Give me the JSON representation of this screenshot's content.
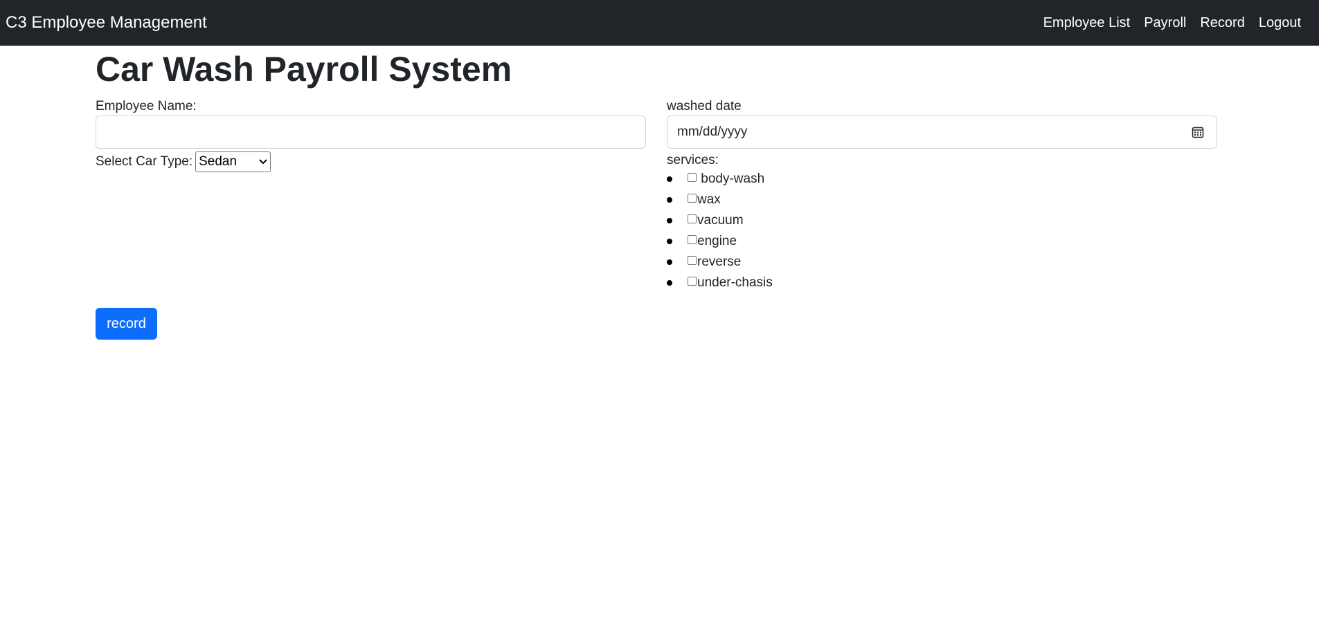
{
  "navbar": {
    "brand": "C3 Employee Management",
    "links": [
      "Employee List",
      "Payroll",
      "Record",
      "Logout"
    ]
  },
  "page": {
    "title": "Car Wash Payroll System"
  },
  "form": {
    "employee_name_label": "Employee Name:",
    "employee_name_value": "",
    "car_type_label": "Select Car Type:",
    "car_type_selected": "Sedan",
    "washed_date_label": "washed date",
    "washed_date_placeholder": "mm/dd/yyyy",
    "services_label": "services:",
    "services": [
      {
        "label": " body-wash",
        "checked": false
      },
      {
        "label": "wax",
        "checked": false
      },
      {
        "label": "vacuum",
        "checked": false
      },
      {
        "label": "engine",
        "checked": false
      },
      {
        "label": "reverse",
        "checked": false
      },
      {
        "label": "under-chasis",
        "checked": false
      }
    ],
    "submit_label": "record"
  },
  "colors": {
    "navbar_bg": "#212529",
    "primary_button": "#0d6efd"
  },
  "icons": {
    "date_picker": "calendar-icon",
    "select_dropdown": "chevron-down-icon"
  }
}
